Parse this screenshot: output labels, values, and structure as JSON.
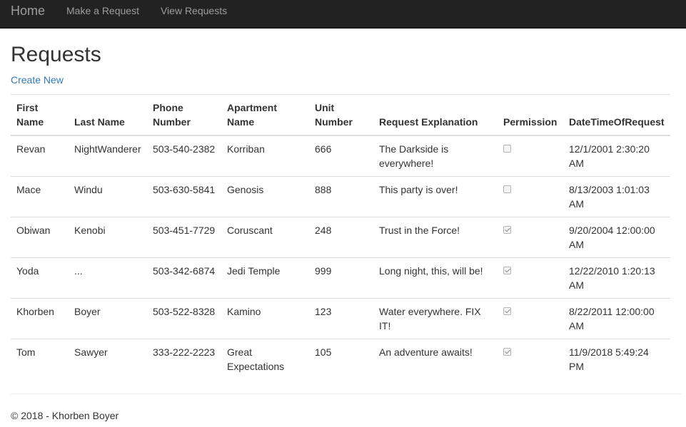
{
  "navbar": {
    "brand": "Home",
    "links": [
      "Make a Request",
      "View Requests"
    ]
  },
  "page": {
    "title": "Requests",
    "create_link": "Create New"
  },
  "table": {
    "headers": [
      "First Name",
      "Last Name",
      "Phone Number",
      "Apartment Name",
      "Unit Number",
      "Request Explanation",
      "Permission",
      "DateTimeOfRequest"
    ],
    "rows": [
      {
        "first": "Revan",
        "last": "NightWanderer",
        "phone": "503-540-2382",
        "apartment": "Korriban",
        "unit": "666",
        "explanation": "The Darkside is everywhere!",
        "permission": false,
        "datetime": "12/1/2001 2:30:20 AM"
      },
      {
        "first": "Mace",
        "last": "Windu",
        "phone": "503-630-5841",
        "apartment": "Genosis",
        "unit": "888",
        "explanation": "This party is over!",
        "permission": false,
        "datetime": "8/13/2003 1:01:03 AM"
      },
      {
        "first": "Obiwan",
        "last": "Kenobi",
        "phone": "503-451-7729",
        "apartment": "Coruscant",
        "unit": "248",
        "explanation": "Trust in the Force!",
        "permission": true,
        "datetime": "9/20/2004 12:00:00 AM"
      },
      {
        "first": "Yoda",
        "last": "...",
        "phone": "503-342-6874",
        "apartment": "Jedi Temple",
        "unit": "999",
        "explanation": "Long night, this, will be!",
        "permission": true,
        "datetime": "12/22/2010 1:20:13 AM"
      },
      {
        "first": "Khorben",
        "last": "Boyer",
        "phone": "503-522-8328",
        "apartment": "Kamino",
        "unit": "123",
        "explanation": "Water everywhere. FIX IT!",
        "permission": true,
        "datetime": "8/22/2011 12:00:00 AM"
      },
      {
        "first": "Tom",
        "last": "Sawyer",
        "phone": "333-222-2223",
        "apartment": "Great Expectations",
        "unit": "105",
        "explanation": "An adventure awaits!",
        "permission": true,
        "datetime": "11/9/2018 5:49:24 PM"
      }
    ]
  },
  "footer": {
    "text": "© 2018 - Khorben Boyer"
  }
}
